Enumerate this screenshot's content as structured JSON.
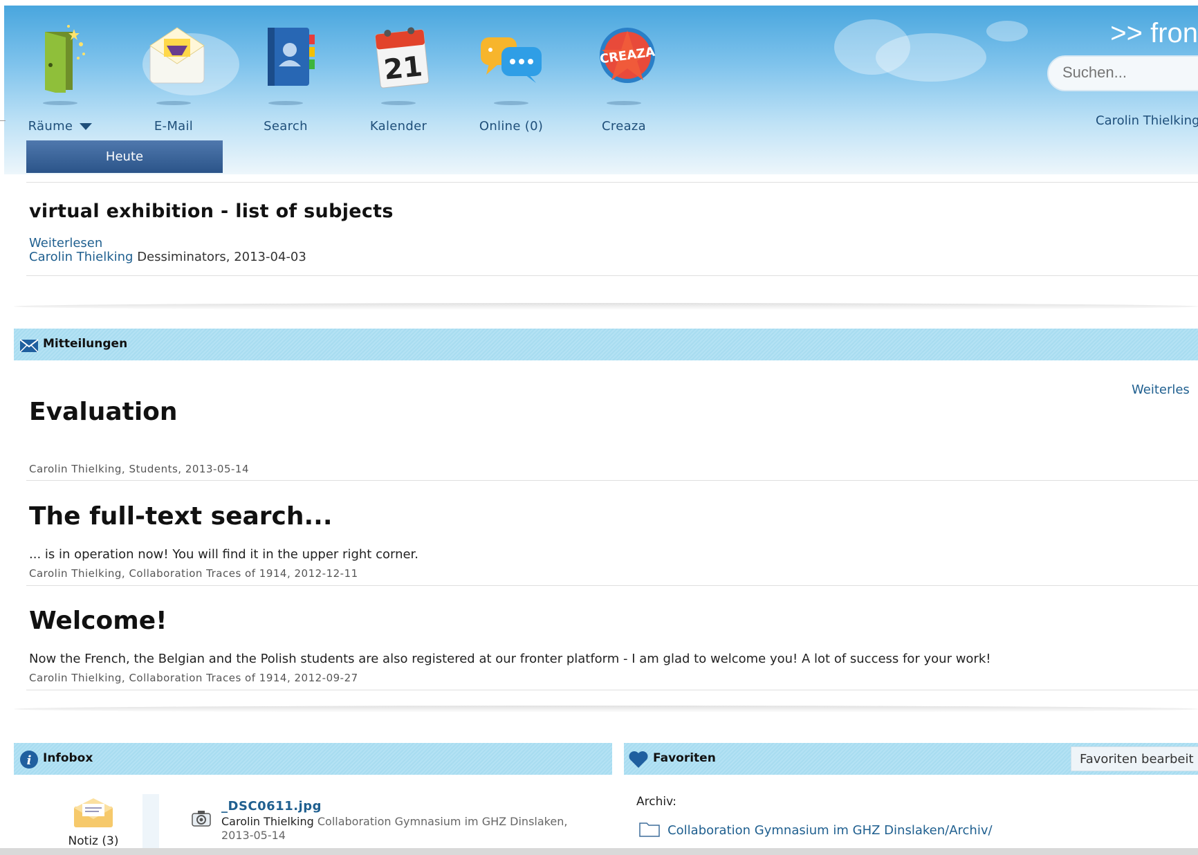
{
  "header": {
    "brand": ">> fron",
    "nav": [
      {
        "label": "Räume",
        "icon": "door-icon"
      },
      {
        "label": "E-Mail",
        "icon": "mail-icon"
      },
      {
        "label": "Search",
        "icon": "address-book-icon"
      },
      {
        "label": "Kalender",
        "icon": "calendar-icon"
      },
      {
        "label": "Online (0)",
        "icon": "chat-icon"
      },
      {
        "label": "Creaza",
        "icon": "creaza-logo-icon"
      }
    ],
    "calendar_day": "21",
    "creaza_text": "CREAZA",
    "search_placeholder": "Suchen...",
    "user": "Carolin Thielking",
    "today_tab": "Heute"
  },
  "featured": {
    "title": "virtual exhibition - list of subjects",
    "read_more": "Weiterlesen",
    "author": "Carolin Thielking",
    "meta": "Dessiminators, 2013-04-03"
  },
  "messages": {
    "title": "Mitteilungen",
    "read_more": "Weiterles",
    "items": [
      {
        "title": "Evaluation",
        "body": "",
        "meta": "Carolin Thielking,  Students,  2013-05-14"
      },
      {
        "title": "The full-text search...",
        "body": "... is in operation now! You will find it in the upper right corner.",
        "meta": "Carolin Thielking,  Collaboration Traces of 1914,  2012-12-11"
      },
      {
        "title": "Welcome!",
        "body": "Now the French, the Belgian and the Polish students are also registered at our fronter platform - I am glad to welcome you! A lot of success for your work!",
        "meta": "Carolin Thielking,  Collaboration Traces of 1914,  2012-09-27"
      }
    ]
  },
  "infobox": {
    "title": "Infobox",
    "note_label": "Notiz (3)",
    "file": {
      "name": "_DSC0611.jpg",
      "author": "Carolin Thielking",
      "location": "Collaboration Gymnasium im GHZ Dinslaken,",
      "date": "2013-05-14"
    }
  },
  "favorites": {
    "title": "Favoriten",
    "edit_button": "Favoriten bearbeit",
    "archive_label": "Archiv:",
    "folder": "Collaboration Gymnasium im GHZ Dinslaken/Archiv/"
  },
  "colors": {
    "header_top": "#49a6de",
    "panel_bar": "#aee0f3",
    "link": "#1f5f8f",
    "tab": "#2b5489"
  }
}
